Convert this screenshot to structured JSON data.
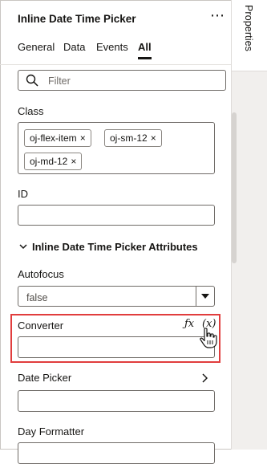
{
  "panel": {
    "title": "Inline Date Time Picker",
    "side_tab": "Properties"
  },
  "tabs": [
    {
      "label": "General"
    },
    {
      "label": "Data"
    },
    {
      "label": "Events"
    },
    {
      "label": "All",
      "active": true
    }
  ],
  "search": {
    "placeholder": "Filter"
  },
  "class_field": {
    "label": "Class",
    "chips": [
      "oj-flex-item",
      "oj-sm-12",
      "oj-md-12"
    ],
    "remove_glyph": "×"
  },
  "id_field": {
    "label": "ID",
    "value": ""
  },
  "section": {
    "label": "Inline Date Time Picker Attributes",
    "expanded": true
  },
  "autofocus": {
    "label": "Autofocus",
    "value": "false"
  },
  "converter": {
    "label": "Converter",
    "fx": "ƒx",
    "var": "(x)",
    "value": ""
  },
  "date_picker": {
    "label": "Date Picker",
    "value": ""
  },
  "day_formatter": {
    "label": "Day Formatter",
    "value": ""
  },
  "colors": {
    "highlight": "#e13d3d",
    "text": "#161513",
    "border": "#6f6b67"
  },
  "icons": [
    "kebab-icon",
    "search-icon",
    "chevron-down-icon",
    "caret-down-icon",
    "hand-pointer-icon",
    "chevron-right-icon"
  ]
}
